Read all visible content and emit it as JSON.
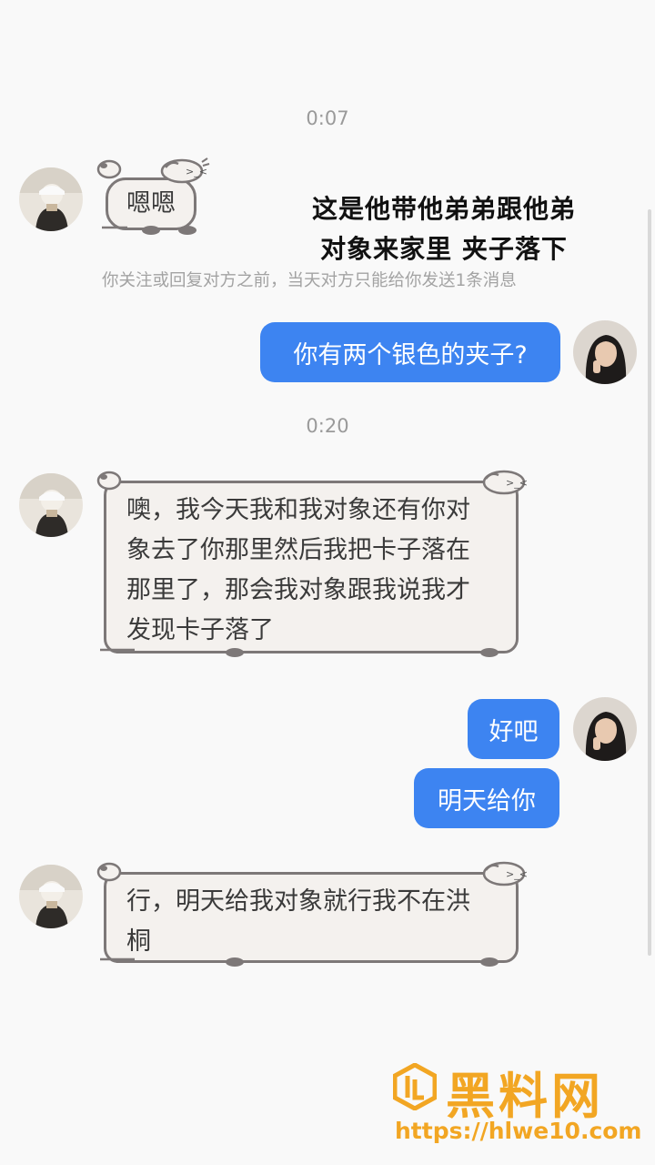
{
  "chat": {
    "time_1": "0:07",
    "time_2": "0:20",
    "notice": "你关注或回复对方之前，当天对方只能给你发送1条消息",
    "messages": [
      {
        "from": "them",
        "text": "嗯嗯"
      },
      {
        "from": "me",
        "text": "你有两个银色的夹子?"
      },
      {
        "from": "them",
        "lines": [
          "噢，我今天我和我对象还有你对",
          "象去了你那里然后我把卡子落在",
          "那里了，那会我对象跟我说我才",
          "发现卡子落了"
        ]
      },
      {
        "from": "me",
        "text": "好吧"
      },
      {
        "from": "me",
        "text": "明天给你"
      },
      {
        "from": "them",
        "lines": [
          "行，明天给我对象就行我不在洪",
          "桐"
        ]
      }
    ]
  },
  "overlay_caption": {
    "line_1": "这是他带他弟弟跟他弟",
    "line_2": "对象来家里 夹子落下"
  },
  "watermark": {
    "name": "黑料网",
    "url": "https://hlwe10.com"
  },
  "colors": {
    "my_bubble": "#3d84f1",
    "their_bubble": "#f4f1ee",
    "their_border": "#7d7878",
    "watermark": "#f2a623"
  },
  "icons": [
    "avatar-sender",
    "avatar-me",
    "sheep-sticker-icon",
    "watermark-logo-icon"
  ]
}
